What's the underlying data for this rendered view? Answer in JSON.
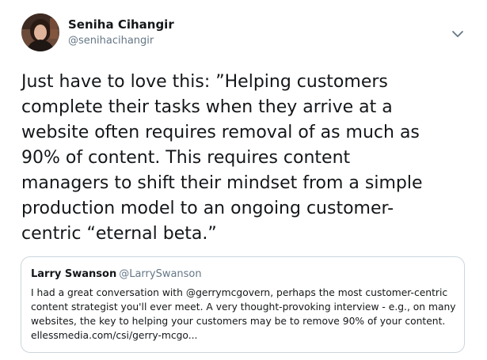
{
  "author": {
    "name": "Seniha Cihangir",
    "handle": "@senihacihangir",
    "avatar_icon": "profile-photo"
  },
  "menu": {
    "icon": "chevron-down-icon"
  },
  "tweet": {
    "text": "Just have to love this: ”Helping customers\ncomplete their tasks when they arrive at a\nwebsite often requires removal of as much as\n90% of content. This requires content\nmanagers to shift their mindset from a simple\nproduction model to an ongoing customer-\ncentric “eternal beta.”"
  },
  "quoted_tweet": {
    "name": "Larry Swanson",
    "handle": "@LarrySwanson",
    "text": "I had a great conversation with @gerrymcgovern, perhaps the most customer-centric\ncontent strategist you'll ever meet. A very thought-provoking interview - e.g., on many\nwebsites, the key to helping your customers may be to remove 90% of your content.",
    "link": "ellessmedia.com/csi/gerry-mcgo..."
  },
  "colors": {
    "text": "#14171a",
    "secondary": "#657786",
    "border": "#ccd6dd"
  }
}
